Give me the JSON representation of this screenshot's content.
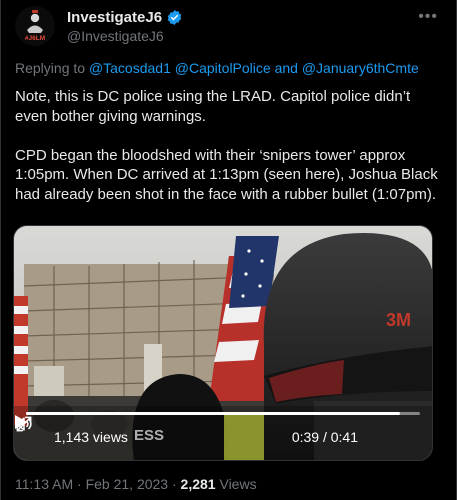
{
  "author": {
    "display_name": "InvestigateJ6",
    "handle": "@InvestigateJ6",
    "verified": true,
    "avatar_icon": "investigatej6-logo",
    "avatar_text": "#J6LM"
  },
  "reply": {
    "prefix": "Replying to",
    "mention1": "@Tacosdad1",
    "mention2": "@CapitolPolice",
    "conjunction": "and",
    "mention3": "@January6thCmte"
  },
  "tweet": {
    "paragraph1": "Note, this is DC police using the LRAD. Capitol police didn’t even bother giving warnings.",
    "paragraph2": "CPD began the bloodshed with their ‘snipers tower’ approx 1:05pm. When DC arrived at 1:13pm (seen here), Joshua Black had already been shot in the face with a rubber bullet (1:07pm)."
  },
  "video": {
    "views": "1,143 views",
    "time": "0:39 / 0:41",
    "progress": 0.95,
    "helmet_text": "3M",
    "press_text": "ESS"
  },
  "meta": {
    "time": "11:13 AM",
    "separator": "·",
    "date": "Feb 21, 2023",
    "view_count": "2,281",
    "views_label": "Views"
  },
  "colors": {
    "background": "#000000",
    "text": "#e7e9ea",
    "secondary": "#71767b",
    "accent": "#1d9bf0"
  }
}
